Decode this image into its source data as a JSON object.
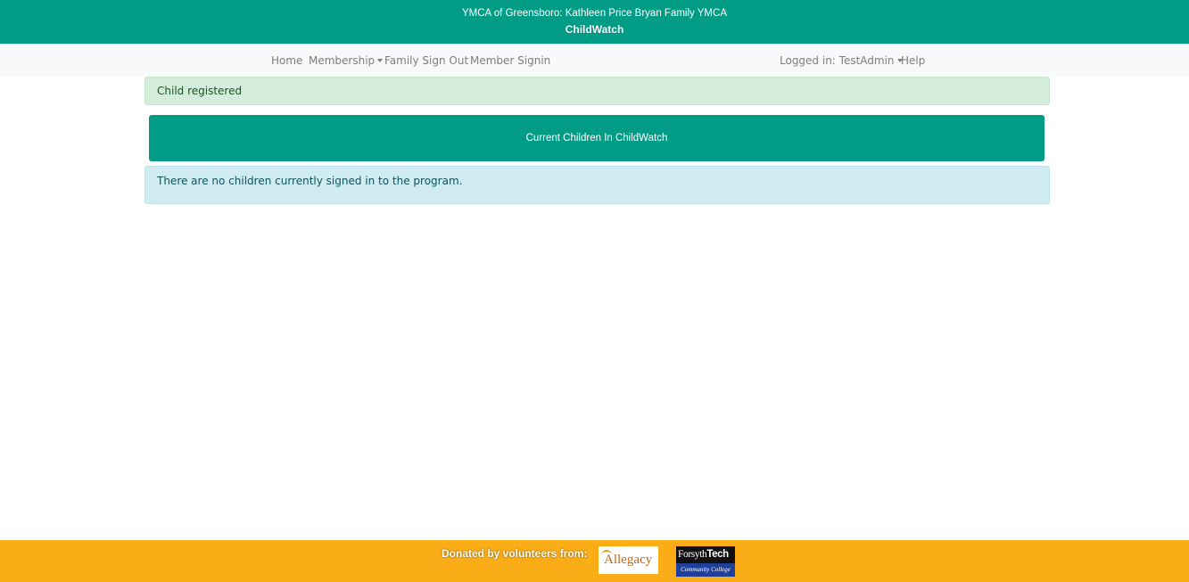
{
  "header": {
    "org_name": "YMCA of Greensboro: Kathleen Price Bryan Family YMCA",
    "app_name": "ChildWatch"
  },
  "nav": {
    "home": "Home",
    "membership": "Membership",
    "family_sign_out": "Family Sign Out",
    "member_signin": "Member Signin",
    "logged_in": "Logged in: TestAdmin",
    "help": "Help"
  },
  "alerts": {
    "success": "Child registered",
    "info": "There are no children currently signed in to the program."
  },
  "current_children": {
    "title": "Current Children In ChildWatch"
  },
  "footer": {
    "donated": "Donated by volunteers from:",
    "sponsors": [
      {
        "name": "Allegacy"
      },
      {
        "name_plain": "Forsyth",
        "name_bold": "Tech",
        "subtitle": "Community College"
      }
    ]
  },
  "colors": {
    "brand_teal": "#009c86",
    "footer_orange": "#fbad18",
    "success_bg": "#d4edda",
    "info_bg": "#d1ecf1"
  }
}
